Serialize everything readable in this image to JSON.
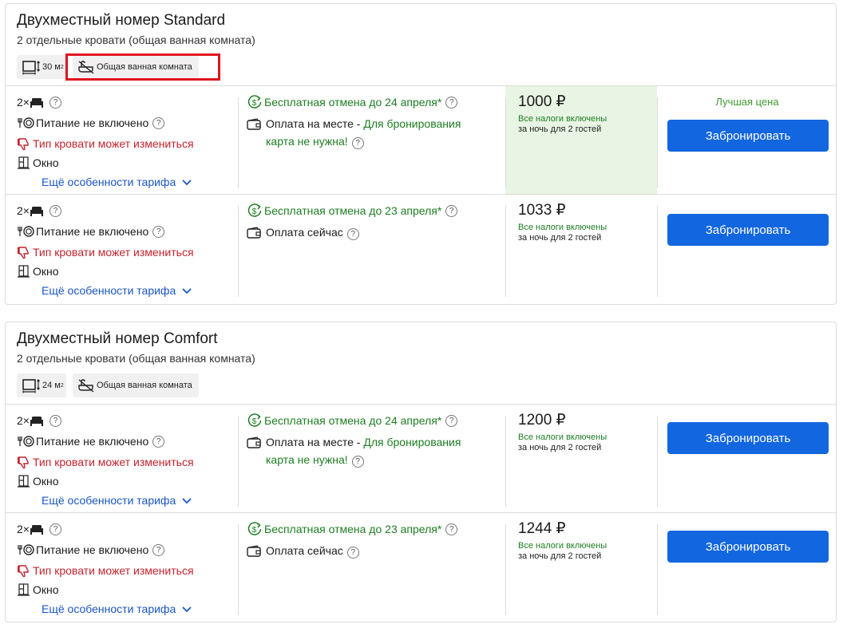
{
  "rooms": [
    {
      "title": "Двухместный номер Standard",
      "subtitle": "2 отдельные кровати (общая ванная комната)",
      "area_value": "30 м",
      "area_sup": "2",
      "bathroom_label": "Общая ванная комната",
      "bathroom_highlighted": true,
      "rates": [
        {
          "guests": "2×",
          "meal": "Питание не включено",
          "bed_notice": "Тип кровати может измениться",
          "window": "Окно",
          "more_link": "Ещё особенности тарифа",
          "cancel": "Бесплатная отмена до 24 апреля*",
          "payment": "Оплата на месте - ",
          "payment_note": "Для бронирования карта не нужна!",
          "price": "1000 ₽",
          "taxes": "Все налоги включены",
          "per_night": "за ночь для 2 гостей",
          "best_label": "Лучшая цена",
          "is_best": true,
          "book_label": "Забронировать"
        },
        {
          "guests": "2×",
          "meal": "Питание не включено",
          "bed_notice": "Тип кровати может измениться",
          "window": "Окно",
          "more_link": "Ещё особенности тарифа",
          "cancel": "Бесплатная отмена до 23 апреля*",
          "payment": "Оплата сейчас",
          "payment_note": "",
          "price": "1033 ₽",
          "taxes": "Все налоги включены",
          "per_night": "за ночь для 2 гостей",
          "best_label": "",
          "is_best": false,
          "book_label": "Забронировать"
        }
      ]
    },
    {
      "title": "Двухместный номер Comfort",
      "subtitle": "2 отдельные кровати (общая ванная комната)",
      "area_value": "24 м",
      "area_sup": "2",
      "bathroom_label": "Общая ванная комната",
      "bathroom_highlighted": false,
      "rates": [
        {
          "guests": "2×",
          "meal": "Питание не включено",
          "bed_notice": "Тип кровати может измениться",
          "window": "Окно",
          "more_link": "Ещё особенности тарифа",
          "cancel": "Бесплатная отмена до 24 апреля*",
          "payment": "Оплата на месте - ",
          "payment_note": "Для бронирования карта не нужна!",
          "price": "1200 ₽",
          "taxes": "Все налоги включены",
          "per_night": "за ночь для 2 гостей",
          "best_label": "",
          "is_best": false,
          "book_label": "Забронировать"
        },
        {
          "guests": "2×",
          "meal": "Питание не включено",
          "bed_notice": "Тип кровати может измениться",
          "window": "Окно",
          "more_link": "Ещё особенности тарифа",
          "cancel": "Бесплатная отмена до 23 апреля*",
          "payment": "Оплата сейчас",
          "payment_note": "",
          "price": "1244 ₽",
          "taxes": "Все налоги включены",
          "per_night": "за ночь для 2 гостей",
          "best_label": "",
          "is_best": false,
          "book_label": "Забронировать"
        }
      ]
    }
  ],
  "help_glyph": "?",
  "chevron_glyph": "⌄",
  "colors": {
    "accent_blue": "#1266e0",
    "link_blue": "#1a56c2",
    "green_text": "#1e7d22",
    "warning_red": "#c4232d",
    "best_bg": "#e8f5e4",
    "highlight_border": "#e0141e"
  }
}
